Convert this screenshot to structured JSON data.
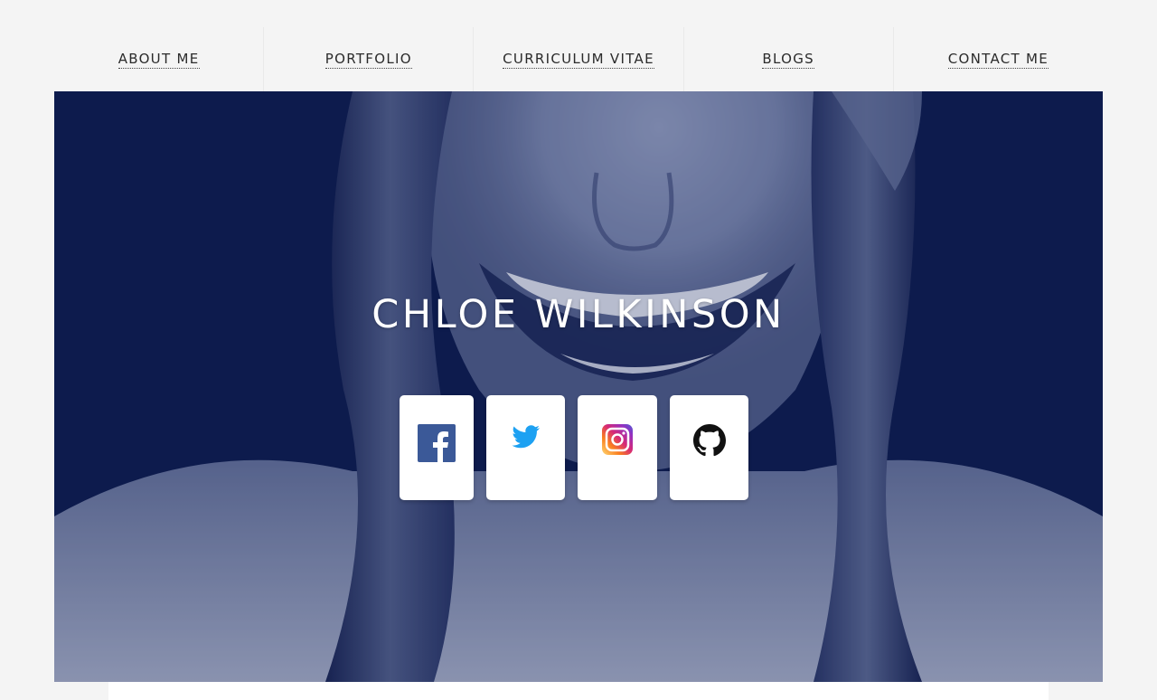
{
  "nav": {
    "items": [
      {
        "label": "ABOUT ME"
      },
      {
        "label": "PORTFOLIO"
      },
      {
        "label": "CURRICULUM VITAE"
      },
      {
        "label": "BLOGS"
      },
      {
        "label": "CONTACT ME"
      }
    ]
  },
  "hero": {
    "name": "CHLOE WILKINSON",
    "overlay_color": "#0d1b4d"
  },
  "social": {
    "items": [
      {
        "icon": "facebook-icon",
        "color": "#3b5998"
      },
      {
        "icon": "twitter-icon",
        "color": "#1da1f2"
      },
      {
        "icon": "instagram-icon",
        "color": "#c13584"
      },
      {
        "icon": "github-icon",
        "color": "#111111"
      }
    ]
  }
}
